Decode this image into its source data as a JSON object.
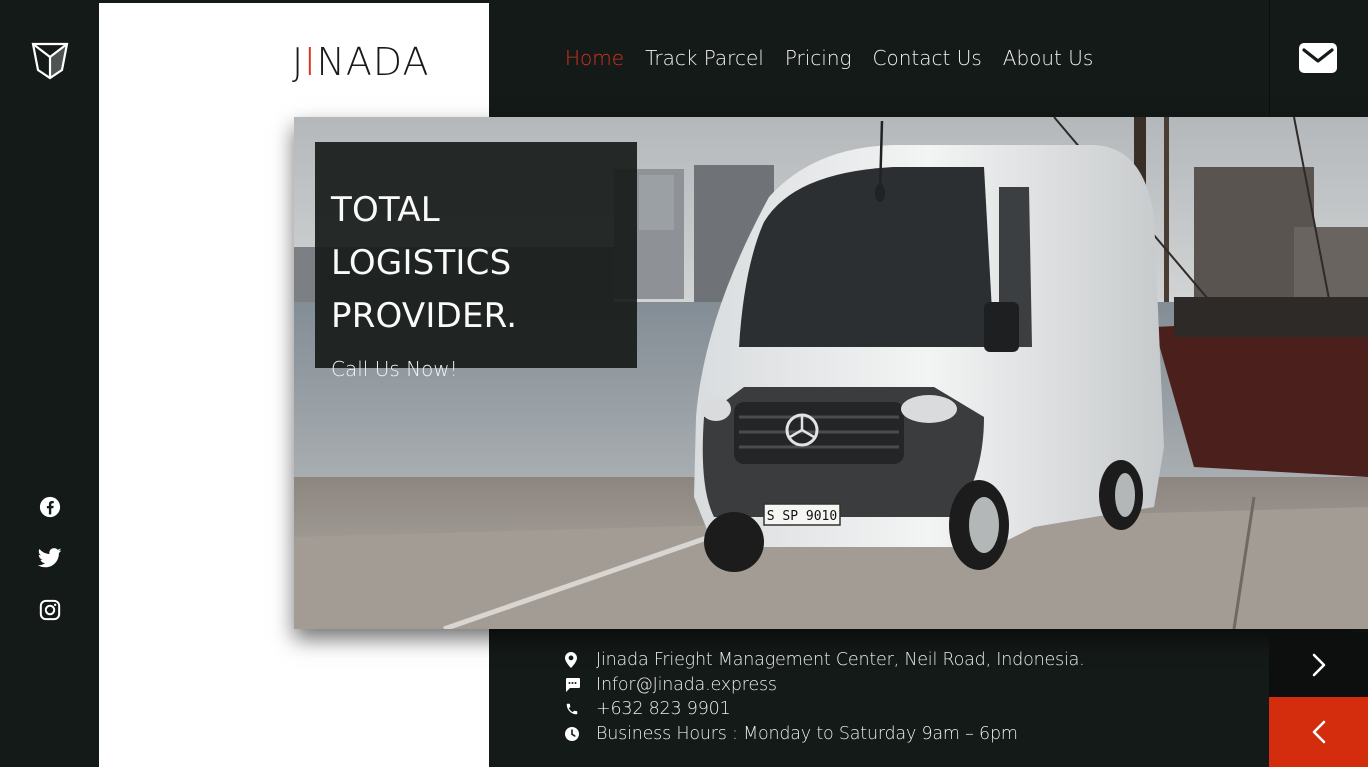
{
  "brand": {
    "prefix": "J",
    "accent": "I",
    "suffix": "NADA"
  },
  "nav": [
    {
      "label": "Home",
      "active": true
    },
    {
      "label": "Track Parcel",
      "active": false
    },
    {
      "label": "Pricing",
      "active": false
    },
    {
      "label": "Contact Us",
      "active": false
    },
    {
      "label": "About Us",
      "active": false
    }
  ],
  "hero": {
    "title_line1": "TOTAL LOGISTICS",
    "title_line2": "PROVIDER.",
    "cta": "Call Us Now!",
    "plate": "S SP 9010"
  },
  "contact": {
    "address": "Jinada Frieght Management Center, Neil Road, Indonesia.",
    "email": "Infor@Jinada.express",
    "phone": "+632 823 9901",
    "hours": "Business Hours : Monday to Saturday 9am – 6pm"
  },
  "social": [
    "facebook-icon",
    "twitter-icon",
    "instagram-icon"
  ],
  "colors": {
    "accent": "#d8321f",
    "dark": "#141a18",
    "panel": "#ffffff"
  }
}
